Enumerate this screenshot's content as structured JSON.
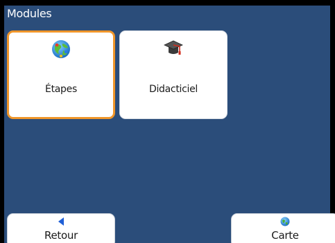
{
  "header": {
    "title": "Modules"
  },
  "modules": [
    {
      "label": "Étapes",
      "icon": "globe-icon",
      "selected": true
    },
    {
      "label": "Didacticiel",
      "icon": "graduation-cap-icon",
      "selected": false
    }
  ],
  "footer": {
    "back_label": "Retour",
    "back_icon": "back-arrow-icon",
    "map_label": "Carte",
    "map_icon": "globe-icon"
  },
  "colors": {
    "background": "#2b4d7a",
    "selected_border": "#f0962a",
    "tile": "#ffffff"
  }
}
